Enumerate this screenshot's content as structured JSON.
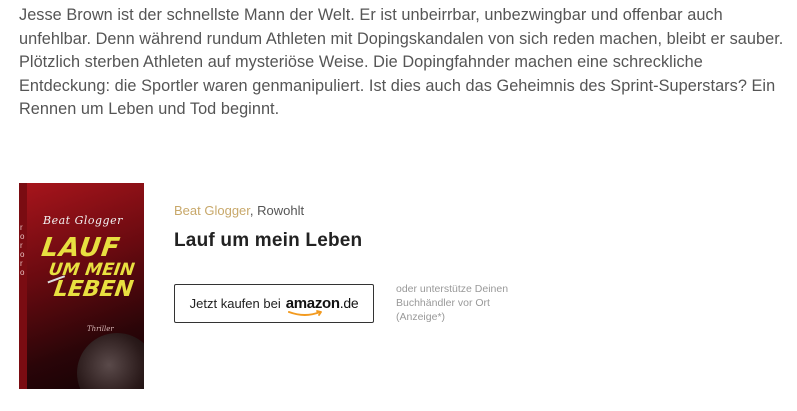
{
  "description": "Jesse Brown ist der schnellste Mann der Welt. Er ist unbeirrbar, unbezwingbar und offenbar auch unfehlbar. Denn während rundum Athleten mit Dopingskandalen von sich reden machen, bleibt er sauber. Plötzlich sterben Athleten auf mysteriöse Weise. Die Dopingfahnder machen eine schreckliche Entdeckung: die Sportler waren genmanipuliert. Ist dies auch das Geheimnis des Sprint-Superstars? Ein Rennen um Leben und Tod beginnt.",
  "book": {
    "author": "Beat Glogger",
    "separator": ", ",
    "publisher": "Rowohlt",
    "title": "Lauf um mein Leben",
    "cover": {
      "author": "Beat Glogger",
      "title_line1": "LAUF",
      "title_line2": "UM MEIN",
      "title_line3": "LEBEN",
      "genre": "Thriller",
      "publisher_mark": "ro ro ro"
    }
  },
  "buy_button": {
    "label": "Jetzt kaufen bei",
    "store_name": "amazon",
    "store_tld": ".de"
  },
  "support_note": {
    "line1": "oder unterstütze Deinen",
    "line2": "Buchhändler vor Ort",
    "line3": "(Anzeige*)"
  },
  "colors": {
    "author_link": "#c8a86a",
    "amazon_smile": "#f29a1f",
    "cover_red": "#a8151c",
    "cover_title": "#e8e040"
  }
}
